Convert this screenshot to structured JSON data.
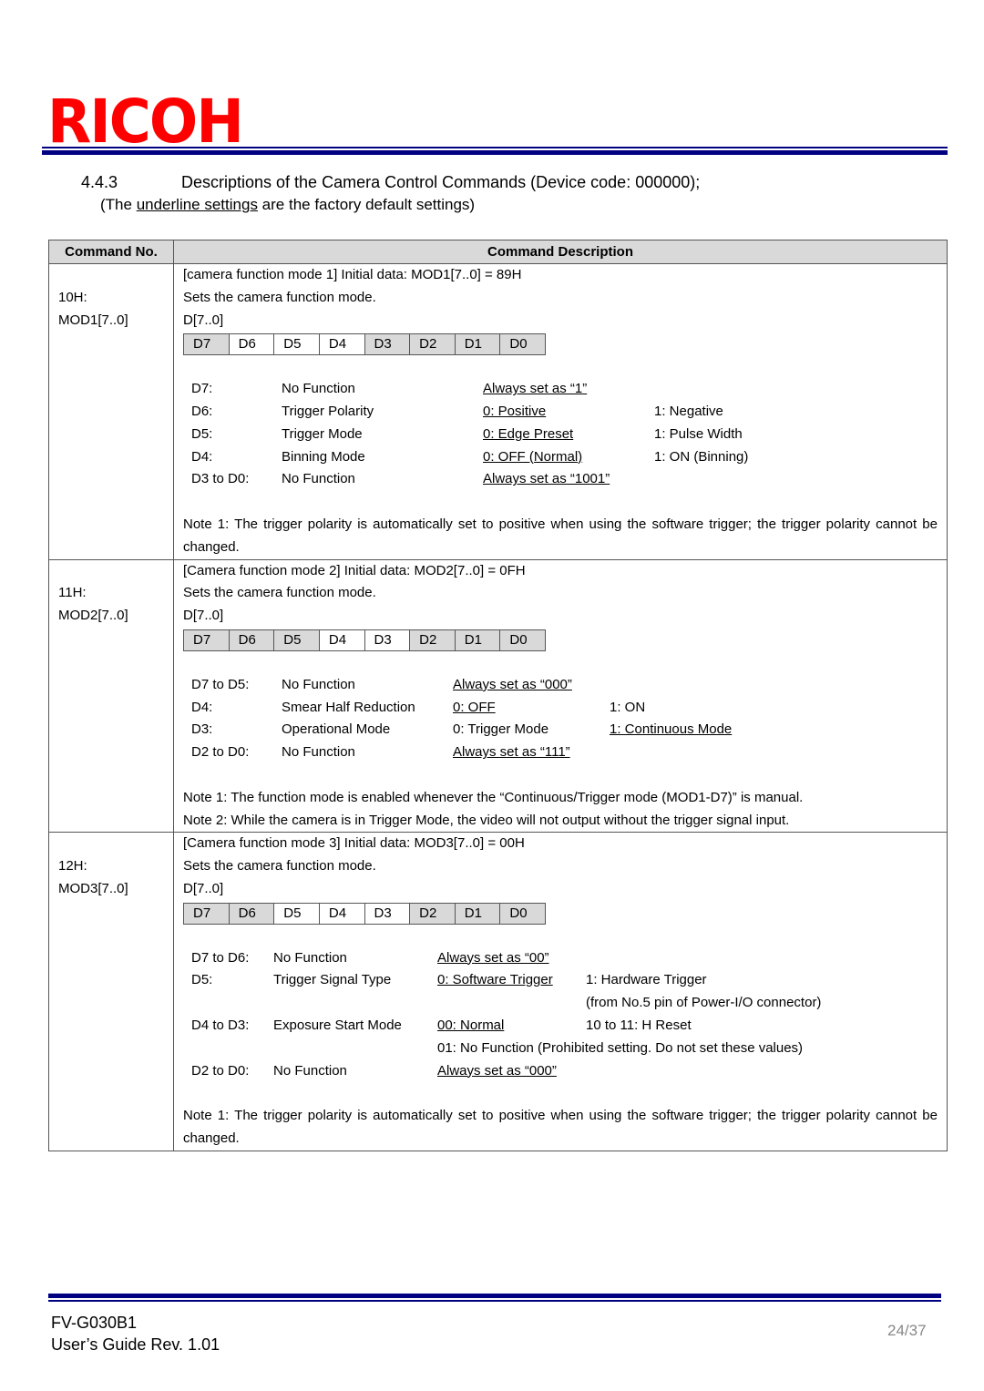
{
  "header": {
    "logo_text": "RICOH",
    "brand_color": "#ff0000",
    "rule_color": "#000080"
  },
  "section": {
    "number": "4.4.3",
    "title": "Descriptions of the Camera Control Commands (Device code: 000000);",
    "subtitle_prefix": "(The ",
    "subtitle_underlined": "underline settings",
    "subtitle_suffix": " are the factory default settings)"
  },
  "table": {
    "headers": {
      "command_no": "Command No.",
      "command_description": "Command Description"
    },
    "rows": [
      {
        "code": "10H:",
        "register": "MOD1[7..0]",
        "title": "[camera function mode 1] Initial data: MOD1[7..0] = 89H",
        "summary": "Sets the camera function mode.",
        "bits_label": "D[7..0]",
        "bits": [
          {
            "label": "D7",
            "shaded": true
          },
          {
            "label": "D6",
            "shaded": false
          },
          {
            "label": "D5",
            "shaded": false
          },
          {
            "label": "D4",
            "shaded": false
          },
          {
            "label": "D3",
            "shaded": true
          },
          {
            "label": "D2",
            "shaded": true
          },
          {
            "label": "D1",
            "shaded": true
          },
          {
            "label": "D0",
            "shaded": true
          }
        ],
        "descriptions": [
          {
            "bit": "D7:",
            "name": "No Function",
            "opt0": "Always set as “1”",
            "opt0_default": true,
            "opt1": "",
            "opt1_default": false
          },
          {
            "bit": "D6:",
            "name": "Trigger Polarity",
            "opt0": "0: Positive",
            "opt0_default": true,
            "opt1": "1: Negative",
            "opt1_default": false
          },
          {
            "bit": "D5:",
            "name": "Trigger Mode",
            "opt0": "0: Edge Preset",
            "opt0_default": true,
            "opt1": "1: Pulse Width",
            "opt1_default": false
          },
          {
            "bit": "D4:",
            "name": "Binning Mode",
            "opt0": "0: OFF (Normal)",
            "opt0_default": true,
            "opt1": "1: ON (Binning)",
            "opt1_default": false
          },
          {
            "bit": "D3 to D0:",
            "name": "No Function",
            "opt0": "Always set as “1001”",
            "opt0_default": true,
            "opt1": "",
            "opt1_default": false
          }
        ],
        "notes": [
          "Note 1: The trigger polarity is automatically set to positive when using the software trigger; the trigger polarity cannot be changed."
        ]
      },
      {
        "code": "11H:",
        "register": "MOD2[7..0]",
        "title": "[Camera function mode 2] Initial data: MOD2[7..0] = 0FH",
        "summary": "Sets the camera function mode.",
        "bits_label": "D[7..0]",
        "bits": [
          {
            "label": "D7",
            "shaded": true
          },
          {
            "label": "D6",
            "shaded": true
          },
          {
            "label": "D5",
            "shaded": true
          },
          {
            "label": "D4",
            "shaded": false
          },
          {
            "label": "D3",
            "shaded": false
          },
          {
            "label": "D2",
            "shaded": true
          },
          {
            "label": "D1",
            "shaded": true
          },
          {
            "label": "D0",
            "shaded": true
          }
        ],
        "descriptions": [
          {
            "bit": "D7 to D5:",
            "name": "No Function",
            "opt0": "Always set as “000”",
            "opt0_default": true,
            "opt1": "",
            "opt1_default": false
          },
          {
            "bit": "D4:",
            "name": "Smear Half Reduction",
            "opt0": "0: OFF",
            "opt0_default": true,
            "opt1": "1: ON",
            "opt1_default": false
          },
          {
            "bit": "D3:",
            "name": "Operational Mode",
            "opt0": "0: Trigger Mode",
            "opt0_default": false,
            "opt1": "1: Continuous Mode",
            "opt1_default": true
          },
          {
            "bit": "D2 to D0:",
            "name": "No Function",
            "opt0": "Always set as “111”",
            "opt0_default": true,
            "opt1": "",
            "opt1_default": false
          }
        ],
        "notes": [
          "Note 1: The function mode is enabled whenever the “Continuous/Trigger mode (MOD1-D7)” is manual.",
          "Note 2: While the camera is in Trigger Mode, the video will not output without the trigger signal input."
        ]
      },
      {
        "code": "12H:",
        "register": "MOD3[7..0]",
        "title": "[Camera function mode 3] Initial data: MOD3[7..0] = 00H",
        "summary": "Sets the camera function mode.",
        "bits_label": "D[7..0]",
        "bits": [
          {
            "label": "D7",
            "shaded": true
          },
          {
            "label": "D6",
            "shaded": true
          },
          {
            "label": "D5",
            "shaded": false
          },
          {
            "label": "D4",
            "shaded": false
          },
          {
            "label": "D3",
            "shaded": false
          },
          {
            "label": "D2",
            "shaded": true
          },
          {
            "label": "D1",
            "shaded": true
          },
          {
            "label": "D0",
            "shaded": true
          }
        ],
        "descriptions": [
          {
            "bit": "D7 to D6:",
            "name": "No Function",
            "opt0": "Always set as “00”",
            "opt0_default": true,
            "opt1": "",
            "opt1_default": false
          },
          {
            "bit": "D5:",
            "name": "Trigger Signal Type",
            "opt0": "0: Software Trigger",
            "opt0_default": true,
            "opt1": "1: Hardware Trigger",
            "opt1_default": false
          },
          {
            "bit": "",
            "name": "",
            "opt0": "",
            "opt0_default": false,
            "opt1": "(from No.5 pin of Power-I/O connector)",
            "opt1_default": false
          },
          {
            "bit": "D4 to D3:",
            "name": "Exposure Start Mode",
            "opt0": "00: Normal",
            "opt0_default": true,
            "opt1": "10 to 11: H Reset",
            "opt1_default": false
          },
          {
            "bit": "",
            "name": "",
            "opt0": "01: No Function (Prohibited setting. Do not set these values)",
            "opt0_default": false,
            "opt1": "",
            "opt1_default": false
          },
          {
            "bit": "D2 to D0:",
            "name": "No Function",
            "opt0": "Always set as “000”",
            "opt0_default": true,
            "opt1": "",
            "opt1_default": false
          }
        ],
        "notes": [
          "Note 1: The trigger polarity is automatically set to positive when using the software trigger; the trigger polarity cannot be changed."
        ]
      }
    ]
  },
  "footer": {
    "model": "FV-G030B1",
    "guide": "User’s Guide Rev. 1.01",
    "page": "24/37"
  }
}
